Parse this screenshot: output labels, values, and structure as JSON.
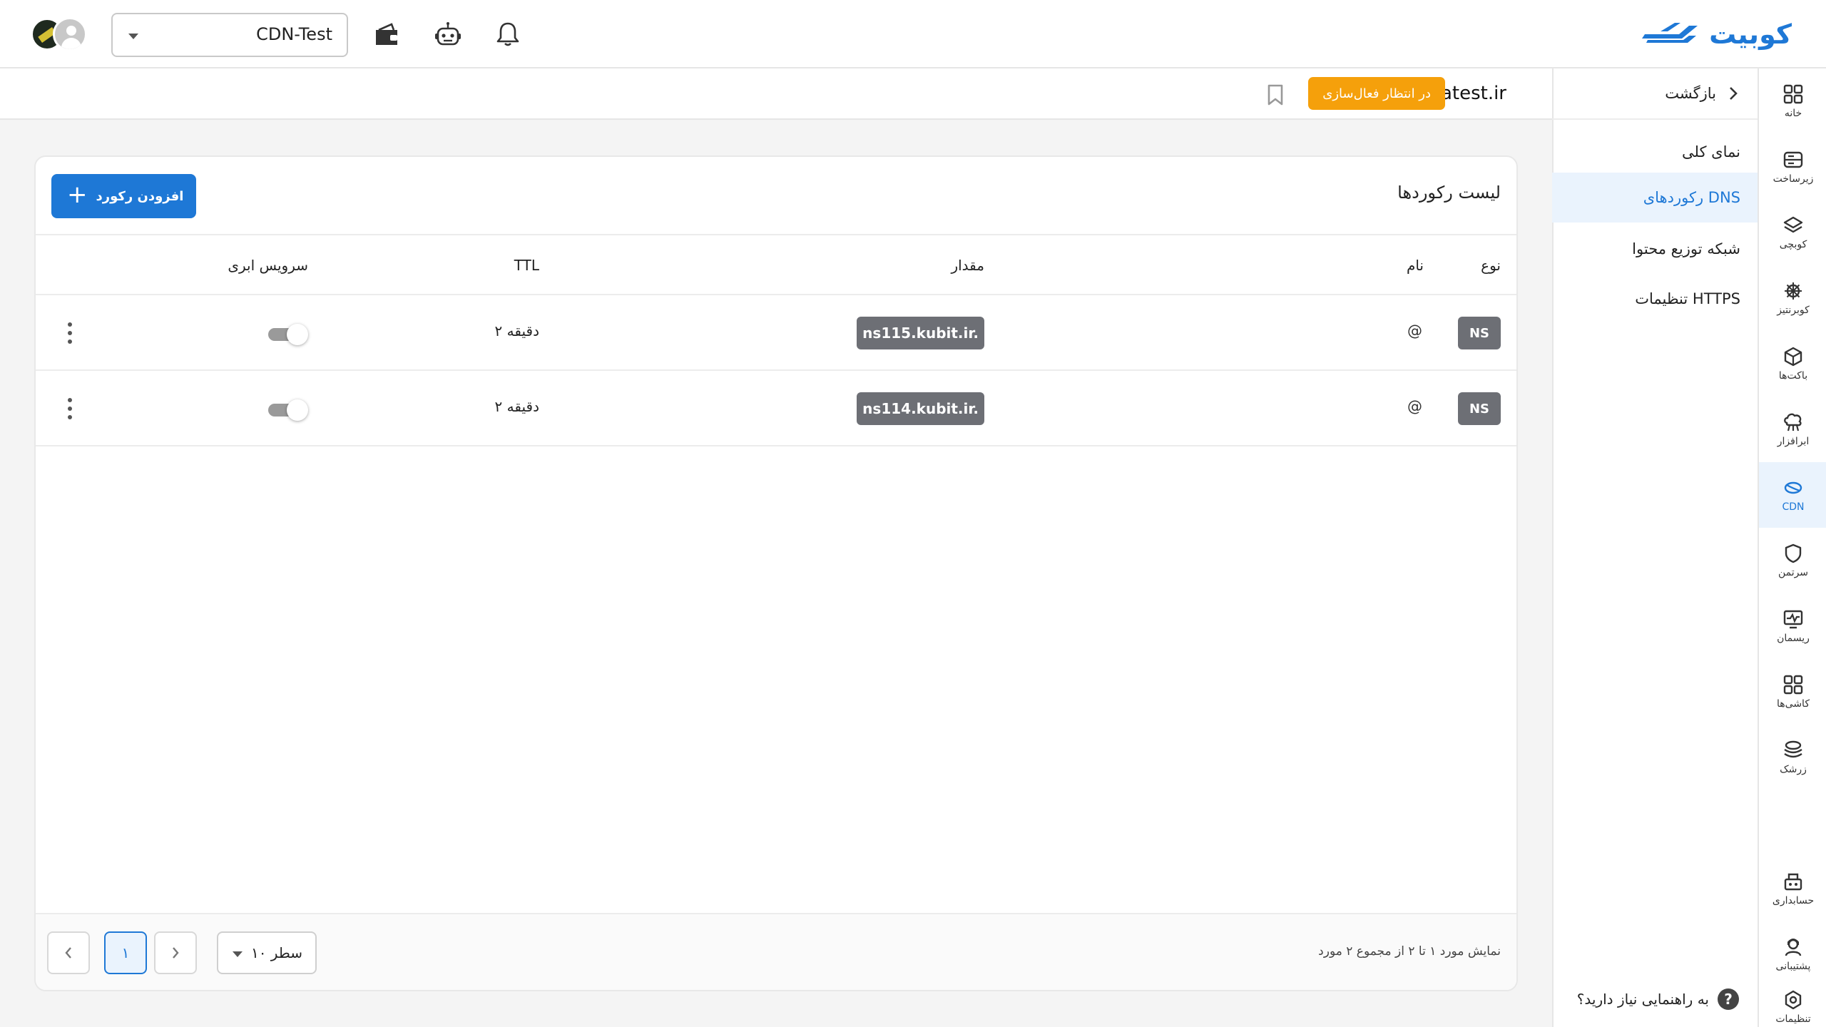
{
  "brand": {
    "name": "کوبیت"
  },
  "header": {
    "project_value": "CDN-Test",
    "icons": [
      "bell-icon",
      "robot-icon",
      "wallet-icon"
    ]
  },
  "rail": {
    "items": [
      {
        "label": "خانه",
        "icon": "home-grid-icon"
      },
      {
        "label": "زیرساخت",
        "icon": "server-icon"
      },
      {
        "label": "کوبچی",
        "icon": "layers-icon"
      },
      {
        "label": "کوبرنتیز",
        "icon": "helm-icon"
      },
      {
        "label": "باکت‌ها",
        "icon": "box-icon"
      },
      {
        "label": "ابرافزار",
        "icon": "cloud-app-icon"
      },
      {
        "label": "CDN",
        "icon": "cdn-icon",
        "active": true
      },
      {
        "label": "سرتمن",
        "icon": "shield-icon"
      },
      {
        "label": "ریسمان",
        "icon": "monitor-icon"
      },
      {
        "label": "کاشی‌ها",
        "icon": "tiles-icon"
      },
      {
        "label": "زرشک",
        "icon": "stack-icon"
      },
      {
        "label": "حسابداری",
        "icon": "accounting-icon"
      },
      {
        "label": "پشتیبانی",
        "icon": "support-icon"
      },
      {
        "label": "تنظیمات",
        "icon": "settings-icon"
      }
    ]
  },
  "subnav": {
    "back_label": "بازگشت",
    "items": [
      {
        "label": "نمای کلی"
      },
      {
        "label": "رکوردهای DNS",
        "active": true
      },
      {
        "label": "شبکه توزیع محتوا"
      },
      {
        "label": "تنظیمات HTTPS"
      }
    ],
    "help_label": "به راهنمایی نیاز دارید؟"
  },
  "domain": {
    "name": "atest.ir",
    "status": "در انتظار فعال‌سازی"
  },
  "records": {
    "title": "لیست رکوردها",
    "add_label": "افزودن رکورد",
    "columns": {
      "type": "نوع",
      "name": "نام",
      "value": "مقدار",
      "ttl": "TTL",
      "cloud": "سرویس ابری"
    },
    "rows": [
      {
        "type": "NS",
        "name": "@",
        "value": "ns115.kubit.ir.",
        "ttl": "۲ دقیقه",
        "cloud": false
      },
      {
        "type": "NS",
        "name": "@",
        "value": "ns114.kubit.ir.",
        "ttl": "۲ دقیقه",
        "cloud": false
      }
    ]
  },
  "pagination": {
    "info": "نمایش مورد ۱ تا ۲ از مجموع ۲ مورد",
    "rows_per_page": "۱۰ سطر",
    "current_page": "۱"
  },
  "colors": {
    "primary": "#1e78d6",
    "badge_pending": "#f5a00b",
    "chip_gray": "#6d6f75",
    "active_bg": "#eaf3fd"
  }
}
